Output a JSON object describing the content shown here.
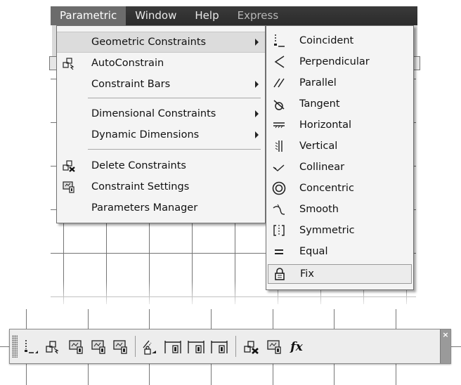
{
  "menubar": {
    "items": [
      {
        "label": "Parametric",
        "state": "active"
      },
      {
        "label": "Window",
        "state": "normal"
      },
      {
        "label": "Help",
        "state": "normal"
      },
      {
        "label": "Express",
        "state": "faded"
      }
    ]
  },
  "parametric_menu": {
    "items": [
      {
        "label": "Geometric Constraints",
        "icon": "none",
        "has_submenu": true,
        "highlighted": true
      },
      {
        "label": "AutoConstrain",
        "icon": "autoconstrain-icon",
        "has_submenu": false
      },
      {
        "label": "Constraint Bars",
        "icon": "none",
        "has_submenu": true
      },
      {
        "label": "Dimensional Constraints",
        "icon": "none",
        "has_submenu": true
      },
      {
        "label": "Dynamic Dimensions",
        "icon": "none",
        "has_submenu": true
      },
      {
        "label": "Delete Constraints",
        "icon": "delete-constraints-icon",
        "has_submenu": false
      },
      {
        "label": "Constraint Settings",
        "icon": "constraint-settings-icon",
        "has_submenu": false
      },
      {
        "label": "Parameters Manager",
        "icon": "none",
        "has_submenu": false
      }
    ]
  },
  "geometric_submenu": {
    "items": [
      {
        "label": "Coincident",
        "icon": "coincident-icon"
      },
      {
        "label": "Perpendicular",
        "icon": "perpendicular-icon"
      },
      {
        "label": "Parallel",
        "icon": "parallel-icon"
      },
      {
        "label": "Tangent",
        "icon": "tangent-icon"
      },
      {
        "label": "Horizontal",
        "icon": "horizontal-icon"
      },
      {
        "label": "Vertical",
        "icon": "vertical-icon"
      },
      {
        "label": "Collinear",
        "icon": "collinear-icon"
      },
      {
        "label": "Concentric",
        "icon": "concentric-icon"
      },
      {
        "label": "Smooth",
        "icon": "smooth-icon"
      },
      {
        "label": "Symmetric",
        "icon": "symmetric-icon"
      },
      {
        "label": "Equal",
        "icon": "equal-icon"
      },
      {
        "label": "Fix",
        "icon": "fix-lock-icon",
        "selected": true
      }
    ]
  },
  "toolbar": {
    "buttons": [
      {
        "icon": "coincident-flyout-icon"
      },
      {
        "icon": "autoconstrain-icon"
      },
      {
        "icon": "show-constraints-icon"
      },
      {
        "icon": "show-all-constraints-icon"
      },
      {
        "icon": "hide-all-constraints-icon"
      },
      {
        "icon": "linear-dimension-icon"
      },
      {
        "icon": "show-dynamic-constraints-icon"
      },
      {
        "icon": "show-all-dynamic-constraints-icon"
      },
      {
        "icon": "hide-all-dynamic-constraints-icon"
      },
      {
        "icon": "delete-constraints-icon"
      },
      {
        "icon": "constraint-settings-icon"
      },
      {
        "icon": "parameters-manager-icon",
        "text": "fx"
      }
    ],
    "close_glyph": "×"
  }
}
